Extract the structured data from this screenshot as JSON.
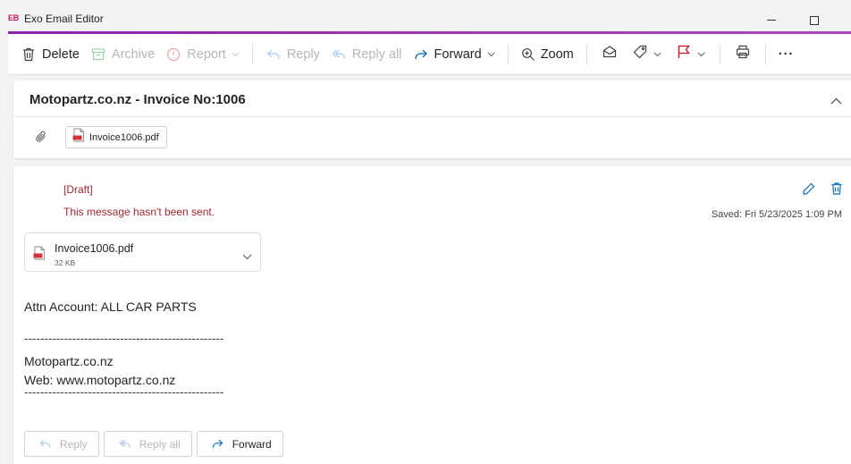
{
  "window": {
    "badge": "EB",
    "title": "Exo Email Editor"
  },
  "toolbar": {
    "delete": "Delete",
    "archive": "Archive",
    "report": "Report",
    "reply": "Reply",
    "reply_all": "Reply all",
    "forward": "Forward",
    "zoom": "Zoom",
    "more": "···"
  },
  "message": {
    "subject": "Motopartz.co.nz -  Invoice No:1006",
    "attachment_chip": "Invoice1006.pdf",
    "draft_tag": "[Draft]",
    "draft_note": "This message hasn't been sent.",
    "saved": "Saved: Fri 5/23/2025 1:09 PM",
    "attachment": {
      "name": "Invoice1006.pdf",
      "size": "32 KB"
    },
    "body": {
      "line1": "Attn Account: ALL CAR PARTS",
      "separator": "--------------------------------------------------",
      "line2": "Motopartz.co.nz",
      "line3": "Web: www.motopartz.co.nz"
    }
  },
  "bottom_actions": {
    "reply": "Reply",
    "reply_all": "Reply all",
    "forward": "Forward"
  },
  "colors": {
    "accent": "#8e24aa",
    "draft": "#a4262c",
    "pdf": "#d13438",
    "forward_arrow": "#0f6cbd",
    "flag": "#c50f1f",
    "report": "#e8a5a5"
  }
}
